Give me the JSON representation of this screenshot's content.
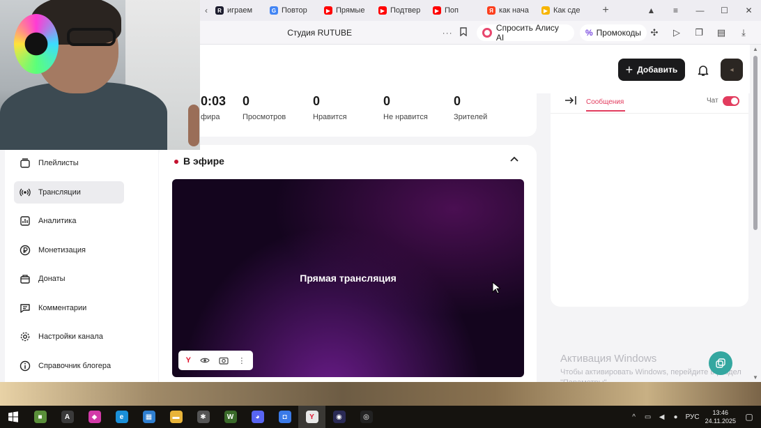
{
  "browser": {
    "tabs": [
      {
        "label": "играем",
        "favicon": "rutube-icon",
        "color": "#1c1c2e",
        "letter": "R"
      },
      {
        "label": "Повтор",
        "favicon": "google-icon",
        "color": "#4285f4",
        "letter": "G"
      },
      {
        "label": "Прямые",
        "favicon": "youtube-icon",
        "color": "#ff0000",
        "letter": "▶"
      },
      {
        "label": "Подтвер",
        "favicon": "youtube-icon",
        "color": "#ff0000",
        "letter": "▶"
      },
      {
        "label": "Поп",
        "favicon": "youtube-icon",
        "color": "#ff0000",
        "letter": "▶"
      },
      {
        "label": "как нача",
        "favicon": "yandex-icon",
        "color": "#fc3f1d",
        "letter": "Я"
      },
      {
        "label": "Как сде",
        "favicon": "play-icon",
        "color": "#f7b500",
        "letter": "▶"
      }
    ],
    "page_title": "Студия RUTUBE",
    "alice_label": "Спросить Алису AI",
    "promo_label": "Промокоды"
  },
  "header": {
    "add_label": "Добавить"
  },
  "stats": [
    {
      "value": "0:03",
      "label": "фира"
    },
    {
      "value": "0",
      "label": "Просмотров"
    },
    {
      "value": "0",
      "label": "Нравится"
    },
    {
      "value": "0",
      "label": "Не нравится"
    },
    {
      "value": "0",
      "label": "Зрителей"
    }
  ],
  "sidebar": {
    "items": [
      {
        "label": "Плейлисты",
        "icon": "playlist-icon"
      },
      {
        "label": "Трансляции",
        "icon": "broadcast-icon",
        "active": true
      },
      {
        "label": "Аналитика",
        "icon": "analytics-icon"
      },
      {
        "label": "Монетизация",
        "icon": "ruble-icon"
      },
      {
        "label": "Донаты",
        "icon": "donate-icon"
      },
      {
        "label": "Комментарии",
        "icon": "comments-icon"
      },
      {
        "label": "Настройки канала",
        "icon": "gear-icon"
      },
      {
        "label": "Справочник блогера",
        "icon": "info-icon"
      }
    ]
  },
  "live": {
    "title": "В эфире",
    "player_text": "Прямая трансляция"
  },
  "chat": {
    "tab_label": "Сообщения",
    "toggle_label": "Чат",
    "toggle_on": true
  },
  "activation": {
    "title": "Активация Windows",
    "subtitle": "Чтобы активировать Windows, перейдите в раздел \"Параметры\"."
  },
  "taskbar": {
    "apps": [
      {
        "name": "minecraft-icon",
        "color": "#5a8f3a",
        "glyph": "■"
      },
      {
        "name": "app-a-icon",
        "color": "#3a3a3a",
        "glyph": "A"
      },
      {
        "name": "flame-icon",
        "color": "#d23aa8",
        "glyph": "◆"
      },
      {
        "name": "edge-icon",
        "color": "#1a8fd8",
        "glyph": "e"
      },
      {
        "name": "store-icon",
        "color": "#2f7fd0",
        "glyph": "▦"
      },
      {
        "name": "folder-icon",
        "color": "#e8b43a",
        "glyph": "▬"
      },
      {
        "name": "spider-icon",
        "color": "#555555",
        "glyph": "✱"
      },
      {
        "name": "app-w-icon",
        "color": "#3a6a2a",
        "glyph": "W"
      },
      {
        "name": "discord-icon",
        "color": "#5865f2",
        "glyph": "◕"
      },
      {
        "name": "roblox-studio-icon",
        "color": "#3a7ae8",
        "glyph": "◘"
      },
      {
        "name": "yandex-browser-icon",
        "color": "#e8e8e8",
        "glyph": "Y"
      },
      {
        "name": "obs-icon",
        "color": "#2a2a55",
        "glyph": "◉"
      },
      {
        "name": "obs-studio-icon",
        "color": "#222222",
        "glyph": "◎"
      }
    ],
    "active_index": 10,
    "lang": "РУС",
    "time": "13:46",
    "date": "24.11.2025"
  }
}
